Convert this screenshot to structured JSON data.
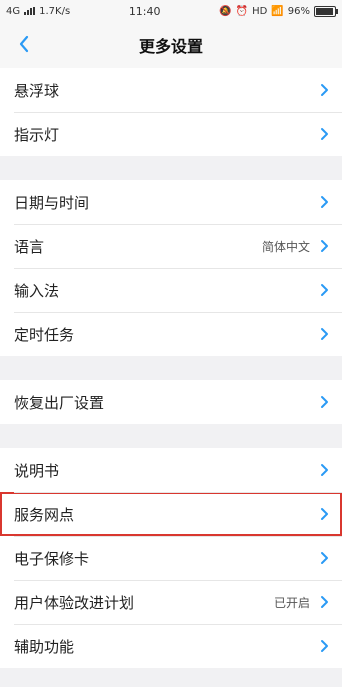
{
  "status_bar": {
    "network": "4G",
    "speed": "1.7K/s",
    "time": "11:40",
    "hd": "HD",
    "battery": "96%",
    "battery_fraction": 0.96
  },
  "header": {
    "back_icon": "chevron-left-icon",
    "title": "更多设置"
  },
  "groups": [
    {
      "items": [
        {
          "label": "悬浮球"
        },
        {
          "label": "指示灯"
        }
      ]
    },
    {
      "items": [
        {
          "label": "日期与时间"
        },
        {
          "label": "语言",
          "value": "简体中文"
        },
        {
          "label": "输入法"
        },
        {
          "label": "定时任务"
        }
      ]
    },
    {
      "items": [
        {
          "label": "恢复出厂设置"
        }
      ]
    },
    {
      "items": [
        {
          "label": "说明书"
        },
        {
          "label": "服务网点",
          "highlighted": true
        },
        {
          "label": "电子保修卡"
        },
        {
          "label": "用户体验改进计划",
          "value": "已开启"
        },
        {
          "label": "辅助功能"
        }
      ]
    }
  ],
  "colors": {
    "accent": "#2a9af5",
    "highlight_border": "#d9372f",
    "background": "#f1f1f3"
  }
}
